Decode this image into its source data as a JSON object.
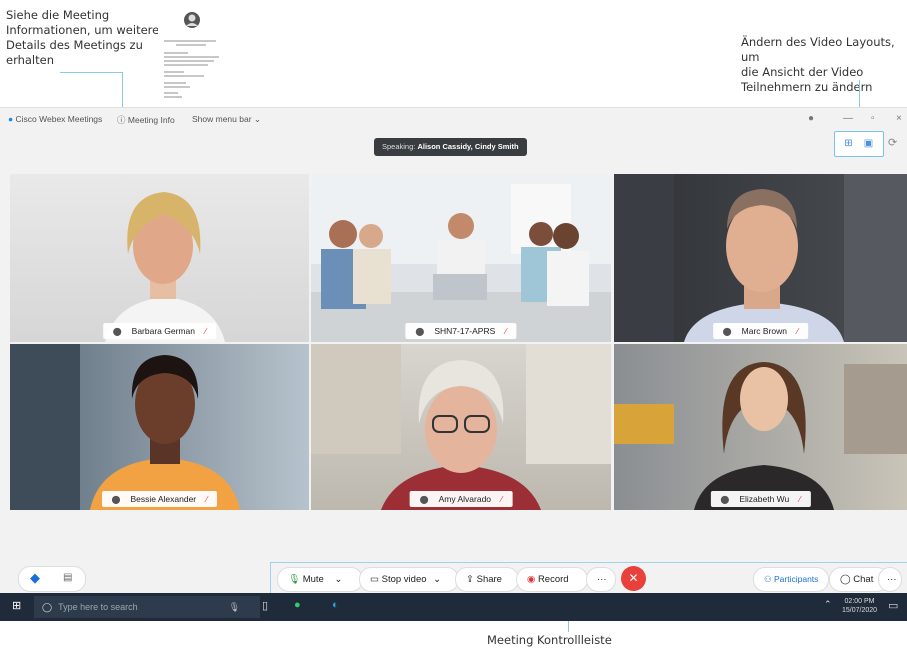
{
  "annotations": {
    "meeting_info": [
      "Siehe die Meeting",
      "Informationen, um weitere",
      "Details des Meetings zu",
      "erhalten"
    ],
    "video_layout": [
      "Ändern des Video Layouts, um",
      "die Ansicht der Video",
      "Teilnehmern zu ändern"
    ],
    "control_bar": "Meeting Kontrollleiste"
  },
  "titlebar": {
    "app_name": "Cisco Webex Meetings",
    "meeting_info": "Meeting Info",
    "show_menu": "Show menu bar"
  },
  "speaking": {
    "prefix": "Speaking:",
    "names": "Alison Cassidy, Cindy Smith"
  },
  "tiles": [
    {
      "name": "Barbara German"
    },
    {
      "name": "SHN7-17-APRS"
    },
    {
      "name": "Marc Brown"
    },
    {
      "name": "Bessie Alexander"
    },
    {
      "name": "Amy Alvarado"
    },
    {
      "name": "Elizabeth Wu"
    }
  ],
  "controls": {
    "mute": "Mute",
    "stop_video": "Stop video",
    "share": "Share",
    "record": "Record",
    "more": "···",
    "participants": "Participants",
    "chat": "Chat"
  },
  "taskbar": {
    "search_placeholder": "Type here to search",
    "time": "02:00 PM",
    "date": "15/07/2020"
  }
}
